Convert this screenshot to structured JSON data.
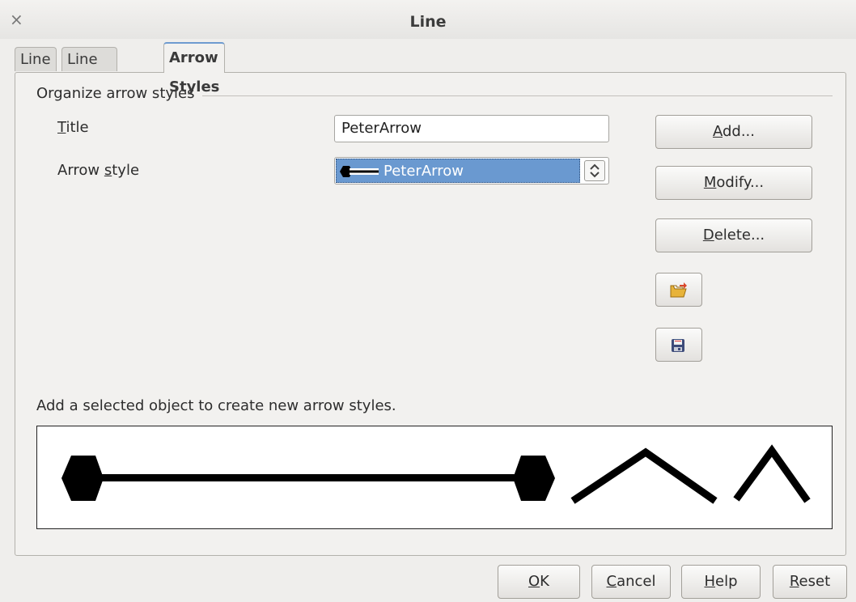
{
  "window": {
    "title": "Line",
    "close_glyph": "×"
  },
  "tabs": [
    {
      "label": "Line",
      "active": false
    },
    {
      "label": "Line Styles",
      "active": false
    },
    {
      "label": "Arrow Styles",
      "active": true
    }
  ],
  "section": {
    "title": "Organize arrow styles"
  },
  "fields": {
    "title_label": {
      "mnemonic": "T",
      "rest": "itle"
    },
    "title_value": "PeterArrow",
    "arrow_style_label": {
      "before": "Arrow ",
      "mnemonic": "s",
      "rest": "tyle"
    },
    "arrow_style_value": "PeterArrow"
  },
  "buttons": {
    "add": {
      "mnemonic": "A",
      "rest": "dd..."
    },
    "modify": {
      "mnemonic": "M",
      "rest": "odify..."
    },
    "delete": {
      "mnemonic": "D",
      "rest": "elete..."
    },
    "load_icon": "open-folder-icon",
    "save_icon": "floppy-disk-icon"
  },
  "hint": "Add a selected object to create new arrow styles.",
  "footer": {
    "ok": {
      "mnemonic": "O",
      "rest": "K"
    },
    "cancel": {
      "mnemonic": "C",
      "rest": "ancel"
    },
    "help": {
      "mnemonic": "H",
      "rest": "elp"
    },
    "reset": {
      "mnemonic": "R",
      "rest": "eset"
    }
  },
  "colors": {
    "selection": "#6a99d0",
    "tab_accent": "#6e9bd0",
    "background": "#efeeec"
  }
}
